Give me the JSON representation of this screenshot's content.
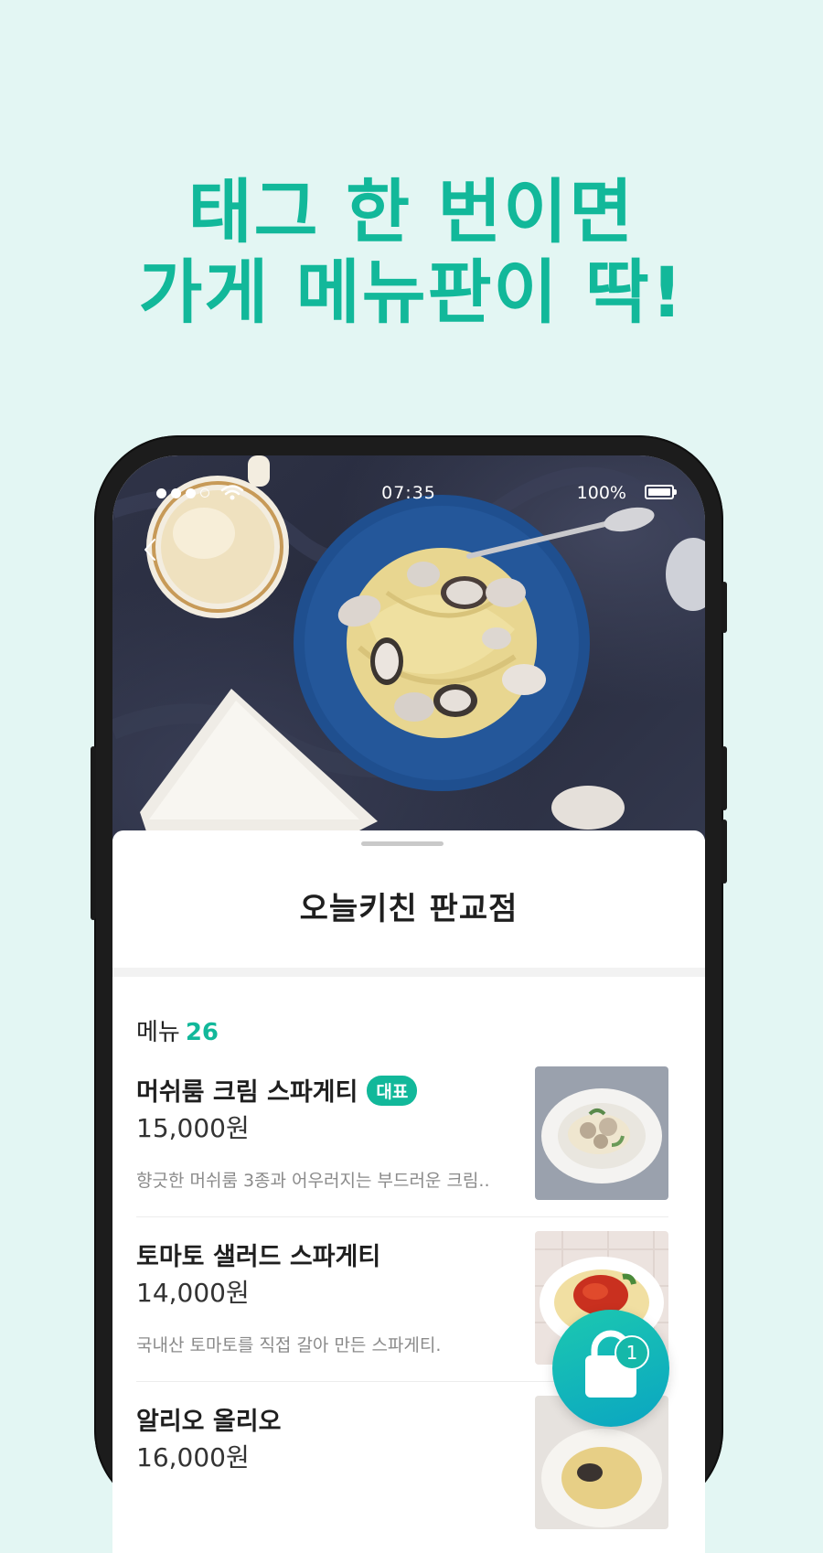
{
  "headline": {
    "line1": "태그 한 번이면",
    "line2": "가게 메뉴판이 딱!"
  },
  "status_bar": {
    "time": "07:35",
    "battery": "100%",
    "signal_icon": "signal-dots-icon",
    "wifi_icon": "wifi-icon",
    "battery_icon": "battery-icon"
  },
  "store": {
    "name": "오늘키친 판교점"
  },
  "menu": {
    "label": "메뉴",
    "count": "26",
    "items": [
      {
        "name": "머쉬룸 크림 스파게티",
        "badge": "대표",
        "price": "15,000원",
        "description": "향긋한 머쉬룸 3종과 어우러지는 부드러운 크림.."
      },
      {
        "name": "토마토 샐러드 스파게티",
        "price": "14,000원",
        "description": "국내산 토마토를 직접 갈아 만든 스파게티."
      },
      {
        "name": "알리오 올리오",
        "price": "16,000원",
        "description": ""
      }
    ]
  },
  "cart": {
    "count": "1",
    "icon": "shopping-bag-icon"
  },
  "colors": {
    "accent": "#12b89a",
    "background": "#e3f6f3"
  }
}
